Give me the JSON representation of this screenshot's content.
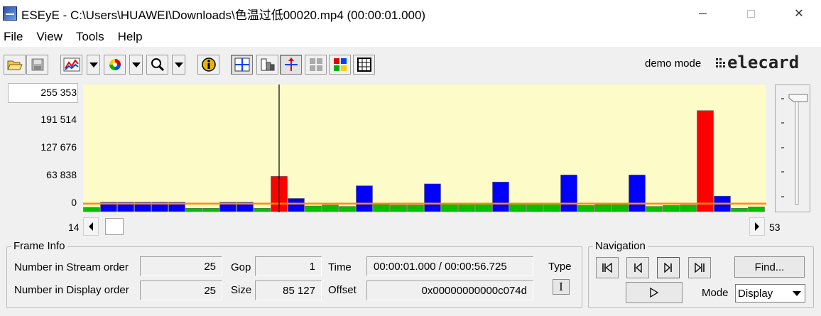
{
  "window": {
    "title": "ESEyE - C:\\Users\\HUAWEI\\Downloads\\色温过低00020.mp4 (00:00:01.000)",
    "controls": {
      "minimize": "minimize",
      "maximize": "maximize",
      "close": "✕"
    }
  },
  "menu": [
    "File",
    "View",
    "Tools",
    "Help"
  ],
  "toolbar": {
    "demo_mode": "demo mode",
    "logo": "elecard"
  },
  "chart_data": {
    "type": "bar",
    "y_tick_labels": [
      "255 353",
      "191 514",
      "127 676",
      "63 838",
      "0"
    ],
    "ylim": [
      0,
      255353
    ],
    "x_start_label": "14",
    "x_end_label": "53",
    "first_frame": 14,
    "last_frame": 53,
    "current_frame": 25,
    "threshold": 17000,
    "series_colors": {
      "I": "#ff0000",
      "P": "#0000ff",
      "B": "#00c000"
    },
    "frames": [
      {
        "frame": 14,
        "type": "B",
        "value": 9000
      },
      {
        "frame": 15,
        "type": "P",
        "value": 20000
      },
      {
        "frame": 16,
        "type": "P",
        "value": 20000
      },
      {
        "frame": 17,
        "type": "P",
        "value": 20000
      },
      {
        "frame": 18,
        "type": "P",
        "value": 20000
      },
      {
        "frame": 19,
        "type": "P",
        "value": 20000
      },
      {
        "frame": 20,
        "type": "B",
        "value": 7000
      },
      {
        "frame": 21,
        "type": "B",
        "value": 7000
      },
      {
        "frame": 22,
        "type": "P",
        "value": 20000
      },
      {
        "frame": 23,
        "type": "P",
        "value": 20000
      },
      {
        "frame": 24,
        "type": "B",
        "value": 7000
      },
      {
        "frame": 25,
        "type": "I",
        "value": 75000
      },
      {
        "frame": 26,
        "type": "P",
        "value": 28000
      },
      {
        "frame": 27,
        "type": "B",
        "value": 12000
      },
      {
        "frame": 28,
        "type": "B",
        "value": 14000
      },
      {
        "frame": 29,
        "type": "B",
        "value": 11000
      },
      {
        "frame": 30,
        "type": "P",
        "value": 55000
      },
      {
        "frame": 31,
        "type": "B",
        "value": 15000
      },
      {
        "frame": 32,
        "type": "B",
        "value": 14000
      },
      {
        "frame": 33,
        "type": "B",
        "value": 14000
      },
      {
        "frame": 34,
        "type": "P",
        "value": 59000
      },
      {
        "frame": 35,
        "type": "B",
        "value": 18000
      },
      {
        "frame": 36,
        "type": "B",
        "value": 16000
      },
      {
        "frame": 37,
        "type": "B",
        "value": 16000
      },
      {
        "frame": 38,
        "type": "P",
        "value": 63000
      },
      {
        "frame": 39,
        "type": "B",
        "value": 18000
      },
      {
        "frame": 40,
        "type": "B",
        "value": 17000
      },
      {
        "frame": 41,
        "type": "B",
        "value": 17000
      },
      {
        "frame": 42,
        "type": "P",
        "value": 78000
      },
      {
        "frame": 43,
        "type": "B",
        "value": 13000
      },
      {
        "frame": 44,
        "type": "B",
        "value": 15000
      },
      {
        "frame": 45,
        "type": "B",
        "value": 15000
      },
      {
        "frame": 46,
        "type": "P",
        "value": 78000
      },
      {
        "frame": 47,
        "type": "B",
        "value": 11000
      },
      {
        "frame": 48,
        "type": "B",
        "value": 13000
      },
      {
        "frame": 49,
        "type": "B",
        "value": 14000
      },
      {
        "frame": 50,
        "type": "I",
        "value": 215000
      },
      {
        "frame": 51,
        "type": "P",
        "value": 33000
      },
      {
        "frame": 52,
        "type": "B",
        "value": 7000
      },
      {
        "frame": 53,
        "type": "B",
        "value": 10000
      }
    ]
  },
  "frame_info": {
    "title": "Frame Info",
    "stream_order_label": "Number in Stream order",
    "stream_order_value": "25",
    "display_order_label": "Number in Display order",
    "display_order_value": "25",
    "gop_label": "Gop",
    "gop_value": "1",
    "size_label": "Size",
    "size_value": "85 127",
    "time_label": "Time",
    "time_value": "00:00:01.000 / 00:00:56.725",
    "offset_label": "Offset",
    "offset_value": "0x00000000000c074d",
    "type_label": "Type",
    "type_value": "I"
  },
  "navigation": {
    "title": "Navigation",
    "find_label": "Find...",
    "mode_label": "Mode",
    "mode_value": "Display"
  }
}
